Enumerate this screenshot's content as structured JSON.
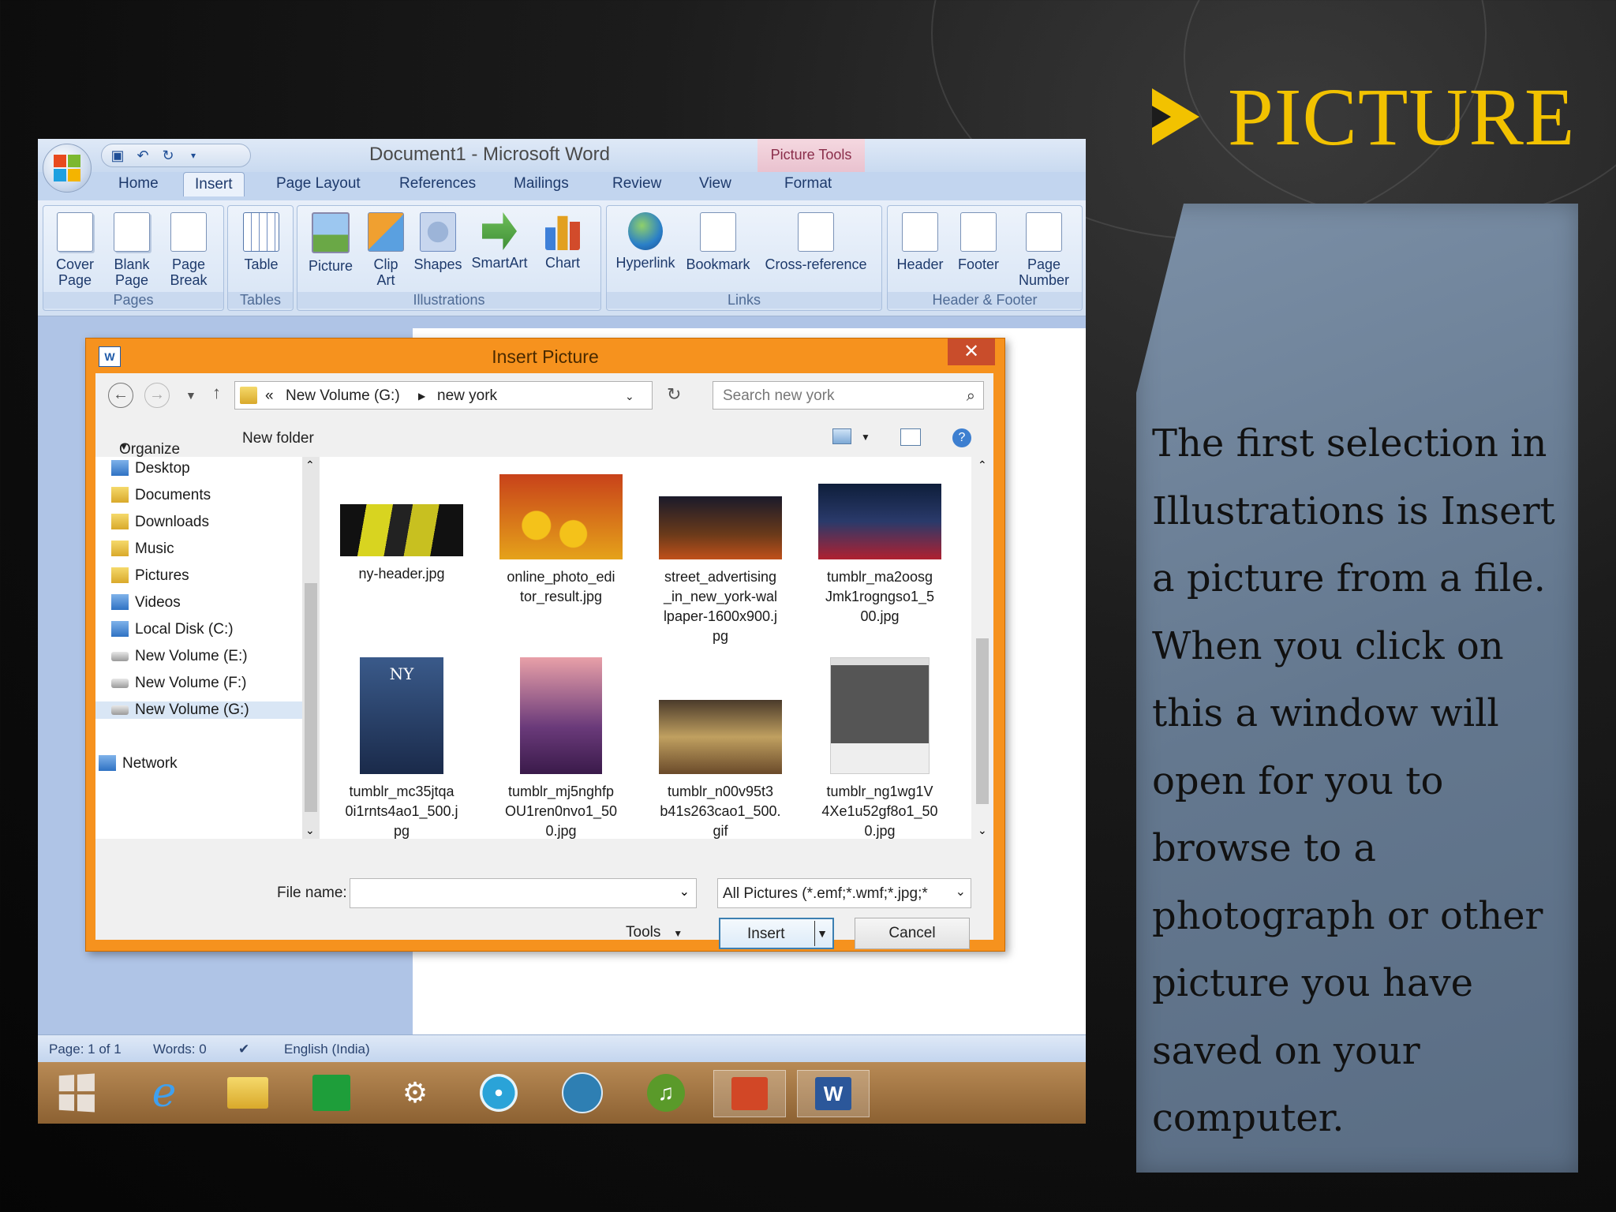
{
  "slide": {
    "title": "PICTURE",
    "body_lines": [
      " The first selection in",
      "Illustrations is Insert",
      "a picture from a file.",
      "When you click on",
      "this a window will",
      "open for you to",
      "browse to a",
      "photograph or other",
      "picture you have",
      "saved on your",
      "computer."
    ]
  },
  "word": {
    "window_title": "Document1  -  Microsoft Word",
    "contextual_tab": "Picture Tools",
    "tabs": [
      "Home",
      "Insert",
      "Page Layout",
      "References",
      "Mailings",
      "Review",
      "View",
      "Format"
    ],
    "active_tab": "Insert",
    "ribbon": {
      "pages": {
        "label": "Pages",
        "cover": "Cover\nPage",
        "blank": "Blank\nPage",
        "break": "Page\nBreak"
      },
      "tables": {
        "label": "Tables",
        "table": "Table"
      },
      "illustrations": {
        "label": "Illustrations",
        "picture": "Picture",
        "clipart": "Clip\nArt",
        "shapes": "Shapes",
        "smartart": "SmartArt",
        "chart": "Chart"
      },
      "links": {
        "label": "Links",
        "hyperlink": "Hyperlink",
        "bookmark": "Bookmark",
        "crossref": "Cross-reference"
      },
      "header_footer": {
        "label": "Header & Footer",
        "header": "Header",
        "footer": "Footer",
        "page_number": "Page\nNumber"
      }
    },
    "status": {
      "page": "Page: 1 of 1",
      "words": "Words: 0",
      "language": "English (India)"
    }
  },
  "dialog": {
    "title": "Insert Picture",
    "close": "✕",
    "address": {
      "prefix": "«",
      "drive": "New Volume (G:)",
      "folder": "new york"
    },
    "search_placeholder": "Search new york",
    "organize": "Organize",
    "new_folder": "New folder",
    "nav_items": [
      "Desktop",
      "Documents",
      "Downloads",
      "Music",
      "Pictures",
      "Videos",
      "Local Disk (C:)",
      "New Volume (E:)",
      "New Volume (F:)",
      "New Volume (G:)"
    ],
    "network": "Network",
    "files": [
      {
        "name": "ny-header.jpg"
      },
      {
        "name": "online_photo_edi\ntor_result.jpg"
      },
      {
        "name": "street_advertising\n_in_new_york-wal\nlpaper-1600x900.j\npg"
      },
      {
        "name": "tumblr_ma2oosg\nJmk1rogngso1_5\n00.jpg"
      },
      {
        "name": "tumblr_mc35jtqa\n0i1rnts4ao1_500.j\npg"
      },
      {
        "name": "tumblr_mj5nghfp\nOU1ren0nvo1_50\n0.jpg"
      },
      {
        "name": "tumblr_n00v95t3\nb41s263cao1_500.\ngif"
      },
      {
        "name": "tumblr_ng1wg1V\n4Xe1u52gf8o1_50\n0.jpg"
      }
    ],
    "file_name_label": "File name:",
    "file_name_value": "",
    "file_type": "All Pictures (*.emf;*.wmf;*.jpg;*",
    "tools": "Tools",
    "insert": "Insert",
    "cancel": "Cancel"
  },
  "colors": {
    "accent_title": "#f2c200",
    "dialog_frame": "#f6921e",
    "panel": "#6a7e95"
  }
}
